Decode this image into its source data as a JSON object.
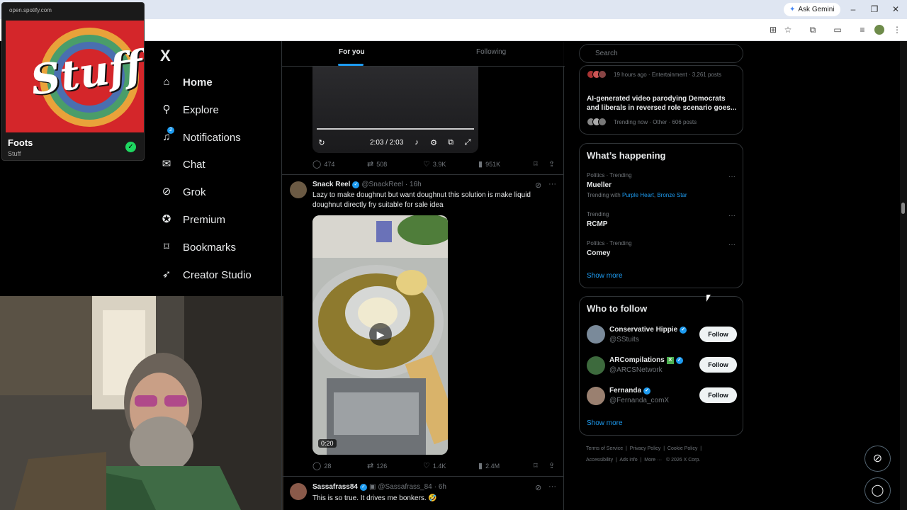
{
  "browser": {
    "ask_gemini": "Ask Gemini",
    "window_controls": [
      "minimize-icon",
      "restore-icon",
      "close-icon"
    ]
  },
  "spotify": {
    "url": "open.spotify.com",
    "title": "Foots",
    "subtitle": "Stuff",
    "art_text": "Stuff"
  },
  "nav": {
    "logo": "X",
    "items": [
      {
        "label": "Home",
        "icon": "home-icon"
      },
      {
        "label": "Explore",
        "icon": "search-icon"
      },
      {
        "label": "Notifications",
        "icon": "bell-icon",
        "badge": "2"
      },
      {
        "label": "Chat",
        "icon": "mail-icon"
      },
      {
        "label": "Grok",
        "icon": "grok-icon"
      },
      {
        "label": "Premium",
        "icon": "premium-icon"
      },
      {
        "label": "Bookmarks",
        "icon": "bookmark-icon"
      },
      {
        "label": "Creator Studio",
        "icon": "rocket-icon"
      }
    ]
  },
  "tabs": {
    "for_you": "For you",
    "following": "Following"
  },
  "video1": {
    "time": "2:03 / 2:03"
  },
  "post1_stats": {
    "replies": "474",
    "reposts": "508",
    "likes": "3.9K",
    "views": "951K"
  },
  "post2": {
    "name": "Snack Reel",
    "handle": "@SnackReel",
    "time": "· 16h",
    "text": "Lazy to make doughnut but want doughnut this solution is make liquid doughnut directly fry suitable for sale idea",
    "duration": "0:20",
    "stats": {
      "replies": "28",
      "reposts": "126",
      "likes": "1.4K",
      "views": "2.4M"
    }
  },
  "post3": {
    "name": "Sassafrass84",
    "handle": "@Sassafrass_84",
    "time": "· 6h",
    "text": "This is so true. It drives me bonkers. 🤣"
  },
  "sidebar": {
    "search_placeholder": "Search",
    "trend_top_meta": "19 hours ago · Entertainment · 3,261 posts",
    "trend_headline": "AI-generated video parodying Democrats and liberals in reversed role scenario goes...",
    "trend_headline_meta": "Trending now · Other · 606 posts",
    "whats_happening": {
      "title": "What’s happening",
      "trends": [
        {
          "meta": "Politics · Trending",
          "name": "Mueller",
          "with_label": "Trending with",
          "with_a": "Purple Heart",
          "with_b": "Bronze Star"
        },
        {
          "meta": "Trending",
          "name": "RCMP"
        },
        {
          "meta": "Politics · Trending",
          "name": "Comey"
        }
      ],
      "show_more": "Show more"
    },
    "who_to_follow": {
      "title": "Who to follow",
      "accounts": [
        {
          "name": "Conservative Hippie",
          "handle": "@SStuits",
          "follow": "Follow"
        },
        {
          "name": "ARCompilations",
          "handle": "@ARCSNetwork",
          "follow": "Follow"
        },
        {
          "name": "Fernanda",
          "handle": "@Fernanda_comX",
          "follow": "Follow"
        }
      ],
      "show_more": "Show more"
    },
    "footer": {
      "terms": "Terms of Service",
      "privacy": "Privacy Policy",
      "cookie": "Cookie Policy",
      "accessibility": "Accessibility",
      "ads": "Ads info",
      "more": "More ···",
      "copyright": "© 2026 X Corp."
    }
  },
  "colors": {
    "accent": "#1d9bf0",
    "background": "#000000",
    "border": "#2f3336",
    "muted": "#71767b"
  }
}
